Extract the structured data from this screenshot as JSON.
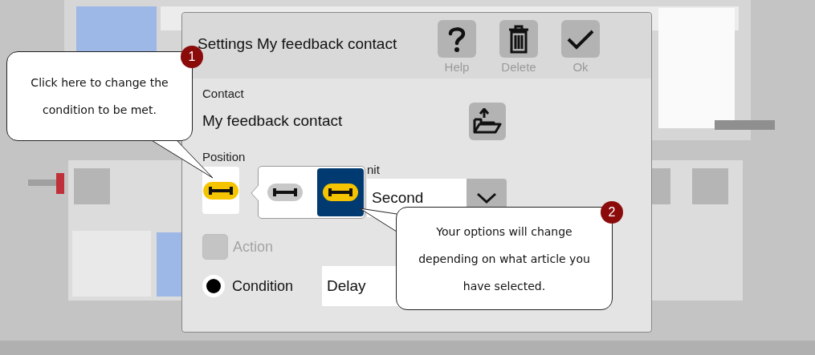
{
  "dialog": {
    "title": "Settings My feedback contact",
    "toolbar": [
      {
        "kind": "help",
        "label": "Help"
      },
      {
        "kind": "delete",
        "label": "Delete"
      },
      {
        "kind": "ok",
        "label": "Ok"
      }
    ],
    "contact": {
      "label": "Contact",
      "value": "My feedback contact"
    },
    "position": {
      "label": "Position",
      "options": [
        {
          "kind": "grey",
          "selected": false
        },
        {
          "kind": "yellow",
          "selected": true
        }
      ]
    },
    "unit": {
      "label": "nit",
      "value": "Second"
    },
    "action": {
      "label": "Action",
      "checked": false,
      "disabled": true
    },
    "condition": {
      "label": "Condition",
      "selected": true,
      "value": "Delay"
    }
  },
  "callouts": [
    {
      "number": "1",
      "text": "Click here to change the condition to be met."
    },
    {
      "number": "2",
      "text": "Your options will change depending on what article you have selected."
    }
  ]
}
